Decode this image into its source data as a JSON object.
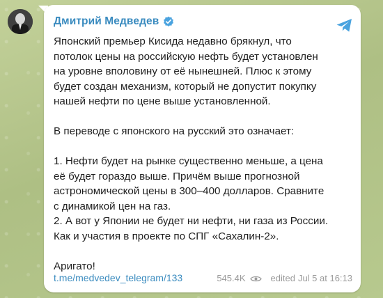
{
  "post": {
    "author": "Дмитрий Медведев",
    "paragraph1": [
      "Японский премьер Кисида недавно брякнул, что",
      "потолок цены на российскую нефть будет установлен",
      "на уровне вполовину от её нынешней. Плюс к этому",
      "будет создан механизм, который не допустит покупку",
      "нашей нефти по цене выше установленной."
    ],
    "paragraph2": "В переводе с японского на русский это означает:",
    "paragraph3": [
      "1. Нефти будет на рынке существенно меньше, а цена",
      "её будет гораздо выше. Причём выше прогнозной",
      "астрономической цены в 300–400 долларов. Сравните",
      "с динамикой цен на газ.",
      "2. А вот у Японии не будет ни нефти, ни газа из России.",
      "Как и участия в проекте по СПГ «Сахалин-2»."
    ],
    "paragraph4": "Аригато!",
    "link": "t.me/medvedev_telegram/133",
    "views": "545.4K",
    "edited_label": "edited",
    "timestamp": "Jul 5 at 16:13"
  },
  "icons": {
    "verified": "verified-badge-icon",
    "telegram": "telegram-plane-icon",
    "views": "eye-icon"
  },
  "colors": {
    "accent": "#3a8bbf",
    "text": "#1f1f1f",
    "meta": "#9a9a9a",
    "bubble": "#ffffff",
    "background": "#b9c98f"
  }
}
